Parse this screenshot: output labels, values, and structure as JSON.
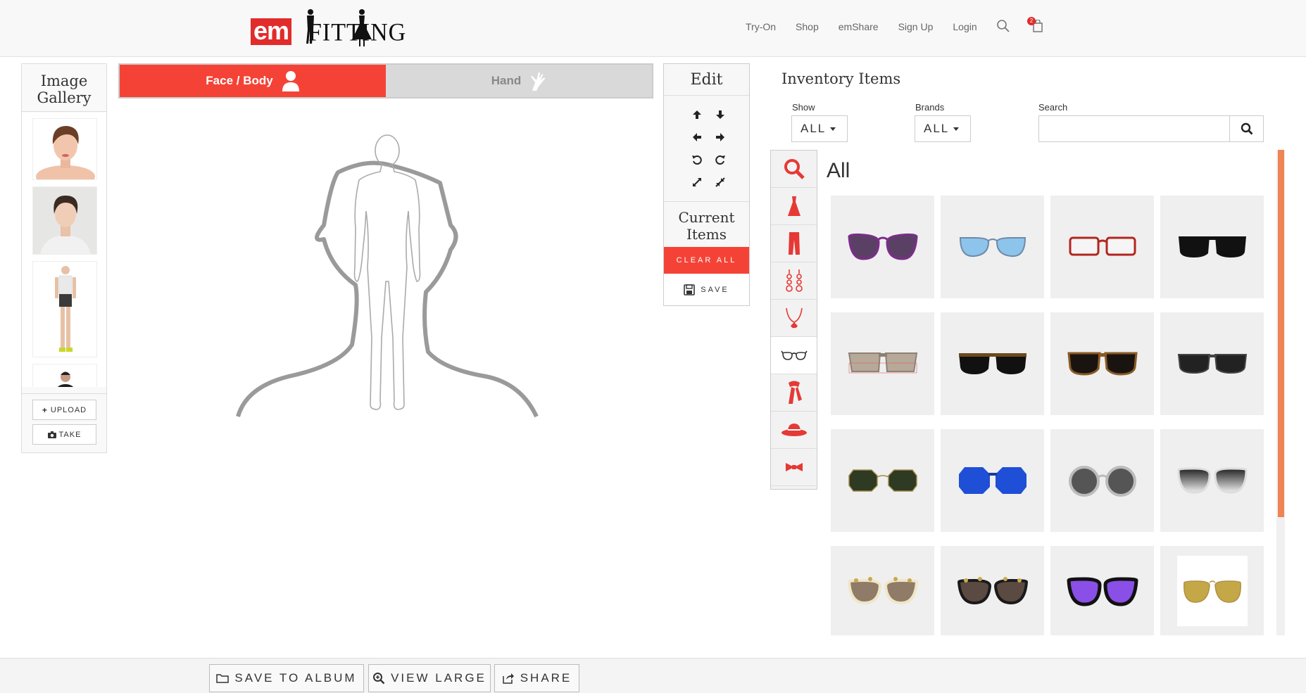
{
  "brand": {
    "logo_em": "em",
    "logo_fitting": "FITTING",
    "accent": "#f44336"
  },
  "nav": {
    "items": [
      "Try-On",
      "Shop",
      "emShare",
      "Sign Up",
      "Login"
    ],
    "cart_count": "2"
  },
  "gallery": {
    "title": "Image Gallery",
    "upload_label": "UPLOAD",
    "take_label": "TAKE"
  },
  "tabs": {
    "face_body": "Face / Body",
    "hand": "Hand"
  },
  "edit": {
    "title": "Edit",
    "current_items": "Current Items",
    "clear_all": "CLEAR ALL",
    "save": "SAVE"
  },
  "inventory": {
    "title": "Inventory Items",
    "show_label": "Show",
    "show_value": "ALL",
    "brands_label": "Brands",
    "brands_value": "ALL",
    "search_label": "Search",
    "search_value": "",
    "grid_title": "All",
    "categories": [
      "search-icon",
      "dress-icon",
      "pants-icon",
      "earrings-icon",
      "necklace-icon",
      "glasses-icon",
      "scarf-icon",
      "hat-icon",
      "bowtie-icon"
    ],
    "selected_category": "glasses-icon"
  },
  "bottom": {
    "save_album": "SAVE TO ALBUM",
    "view_large": "VIEW LARGE",
    "share": "SHARE"
  }
}
